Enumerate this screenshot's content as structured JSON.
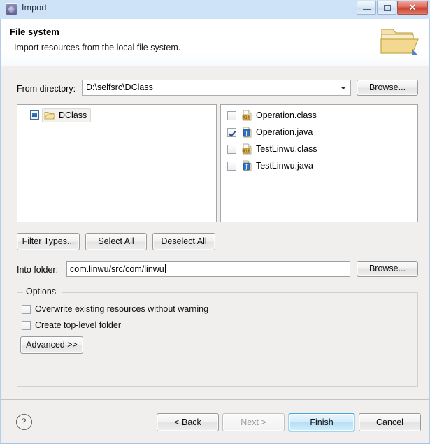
{
  "window": {
    "title": "Import",
    "icon": "eclipse-import-icon",
    "controls": {
      "minimize": "minimize-button",
      "maximize": "maximize-button",
      "close_glyph": "✕"
    }
  },
  "header": {
    "title": "File system",
    "description": "Import resources from the local file system.",
    "icon": "open-folder-icon"
  },
  "from_directory": {
    "label": "From directory:",
    "value": "D:\\selfsrc\\DClass",
    "browse_label": "Browse..."
  },
  "tree": {
    "items": [
      {
        "label": "DClass",
        "checkbox_state": "grayed",
        "selected": true,
        "icon": "folder-icon"
      }
    ]
  },
  "file_list": {
    "items": [
      {
        "label": "Operation.class",
        "checked": false,
        "icon": "class-file-icon"
      },
      {
        "label": "Operation.java",
        "checked": true,
        "icon": "java-file-icon"
      },
      {
        "label": "TestLinwu.class",
        "checked": false,
        "icon": "class-file-icon"
      },
      {
        "label": "TestLinwu.java",
        "checked": false,
        "icon": "java-file-icon"
      }
    ]
  },
  "selection_buttons": {
    "filter_types": "Filter Types...",
    "select_all": "Select All",
    "deselect_all": "Deselect All"
  },
  "into_folder": {
    "label": "Into folder:",
    "value": "com.linwu/src/com/linwu",
    "browse_label": "Browse..."
  },
  "options": {
    "legend": "Options",
    "checkboxes": [
      {
        "label": "Overwrite existing resources without warning",
        "checked": false
      },
      {
        "label": "Create top-level folder",
        "checked": false
      }
    ],
    "advanced_label": "Advanced  >>"
  },
  "footer": {
    "help": "?",
    "back": "< Back",
    "next": "Next >",
    "finish": "Finish",
    "cancel": "Cancel"
  },
  "colors": {
    "titlebar": "#c3dbf4",
    "close_button": "#c8412f",
    "default_button_border": "#3fa8d8",
    "body_background": "#f0efee",
    "checkbox_check": "#2a4b8d"
  }
}
